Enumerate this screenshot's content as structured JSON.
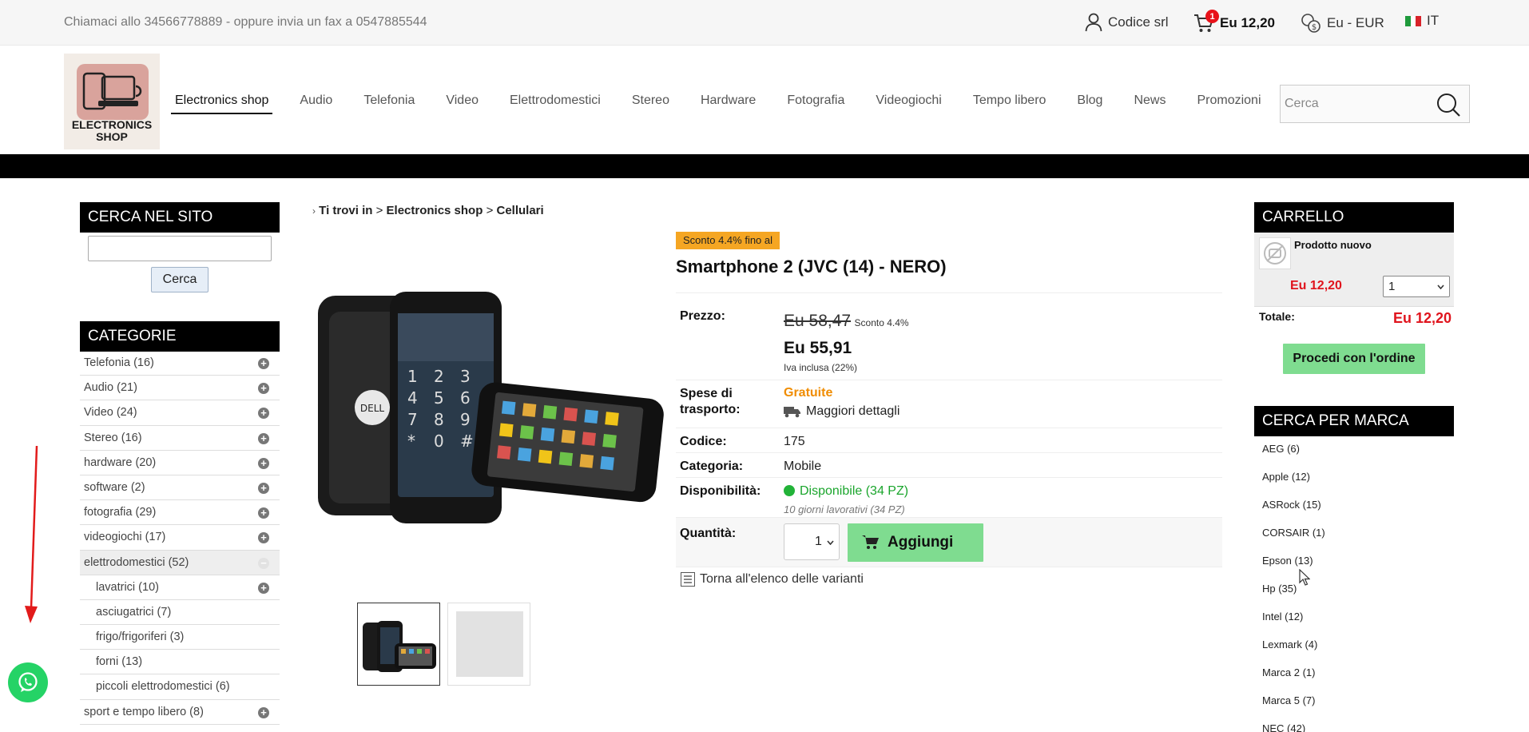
{
  "topbar": {
    "contact": "Chiamaci allo 34566778889 - oppure invia un fax a 0547885544",
    "account": "Codice srl",
    "cart_count": "1",
    "cart_total": "Eu 12,20",
    "currency": "Eu - EUR",
    "language": "IT"
  },
  "logo": {
    "line1": "ELECTRONICS",
    "line2": "SHOP"
  },
  "nav": {
    "items": [
      "Electronics shop",
      "Audio",
      "Telefonia",
      "Video",
      "Elettrodomestici",
      "Stereo",
      "Hardware",
      "Fotografia",
      "Videogiochi",
      "Tempo libero",
      "Blog",
      "News",
      "Promozioni"
    ],
    "search_placeholder": "Cerca"
  },
  "sidebar": {
    "search_title": "CERCA NEL SITO",
    "search_button": "Cerca",
    "categories_title": "CATEGORIE",
    "categories": [
      "Telefonia (16)",
      "Audio (21)",
      "Video (24)",
      "Stereo (16)",
      "hardware (20)",
      "software (2)",
      "fotografia (29)",
      "videogiochi (17)",
      "elettrodomestici (52)",
      "lavatrici (10)",
      "asciugatrici (7)",
      "frigo/frigoriferi (3)",
      "forni (13)",
      "piccoli elettrodomestici (6)",
      "sport e tempo libero (8)"
    ]
  },
  "breadcrumb": {
    "prefix": "Ti trovi in",
    "sep": ">",
    "level1": "Electronics shop",
    "level2": "Cellulari"
  },
  "product": {
    "badge": "Sconto 4.4% fino al",
    "title": "Smartphone 2 (JVC (14) - NERO)",
    "price_label": "Prezzo:",
    "old_price": "Eu 58,47",
    "discount": "Sconto 4.4%",
    "new_price": "Eu 55,91",
    "vat": "Iva inclusa (22%)",
    "shipping_label_1": "Spese di",
    "shipping_label_2": "trasporto:",
    "shipping_value": "Gratuite",
    "shipping_details": "Maggiori dettagli",
    "code_label": "Codice:",
    "code_value": "175",
    "category_label": "Categoria:",
    "category_value": "Mobile",
    "availability_label": "Disponibilità:",
    "availability_value": "Disponibile (34 PZ)",
    "availability_note": "10 giorni lavorativi (34 PZ)",
    "quantity_label": "Quantità:",
    "quantity_value": "1",
    "add_button": "Aggiungi",
    "back_link": "Torna all'elenco delle varianti"
  },
  "cart": {
    "title": "CARRELLO",
    "product_name": "Prodotto nuovo",
    "product_price": "Eu 12,20",
    "qty": "1",
    "total_label": "Totale:",
    "total_value": "Eu 12,20",
    "order_button": "Procedi con l'ordine"
  },
  "brands": {
    "title": "CERCA PER MARCA",
    "items": [
      "AEG (6)",
      "Apple (12)",
      "ASRock (15)",
      "CORSAIR (1)",
      "Epson (13)",
      "Hp (35)",
      "Intel (12)",
      "Lexmark (4)",
      "Marca 2 (1)",
      "Marca 5 (7)",
      "NEC (42)"
    ]
  }
}
